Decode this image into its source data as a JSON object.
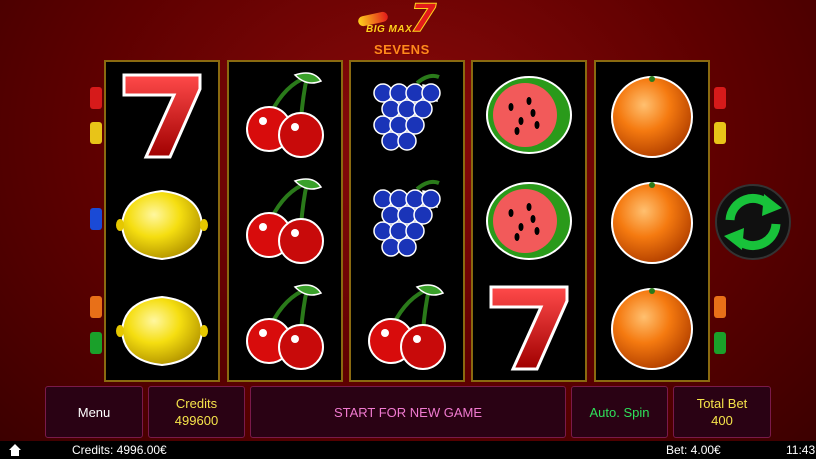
{
  "game": {
    "logo_top": "BIG MAX",
    "logo_seven": "7",
    "logo_bottom": "SEVENS"
  },
  "reels": [
    [
      "seven",
      "lemon",
      "lemon"
    ],
    [
      "cherry",
      "cherry",
      "cherry"
    ],
    [
      "grapes",
      "grapes",
      "cherry"
    ],
    [
      "watermelon",
      "watermelon",
      "seven"
    ],
    [
      "orange",
      "orange",
      "orange"
    ]
  ],
  "symbol_glyphs": {
    "seven": "7"
  },
  "controls": {
    "menu_label": "Menu",
    "credits_label": "Credits",
    "credits_value": "499600",
    "start_label": "START FOR NEW GAME",
    "autospin_label": "Auto. Spin",
    "totalbet_label": "Total Bet",
    "totalbet_value": "400"
  },
  "status": {
    "credits": "Credits: 4996.00€",
    "bet": "Bet: 4.00€",
    "time": "11:43"
  },
  "colors": {
    "accent": "#f5e34a",
    "autospin": "#2ee05a",
    "start": "#f07ad0",
    "spin": "#18c23a"
  }
}
